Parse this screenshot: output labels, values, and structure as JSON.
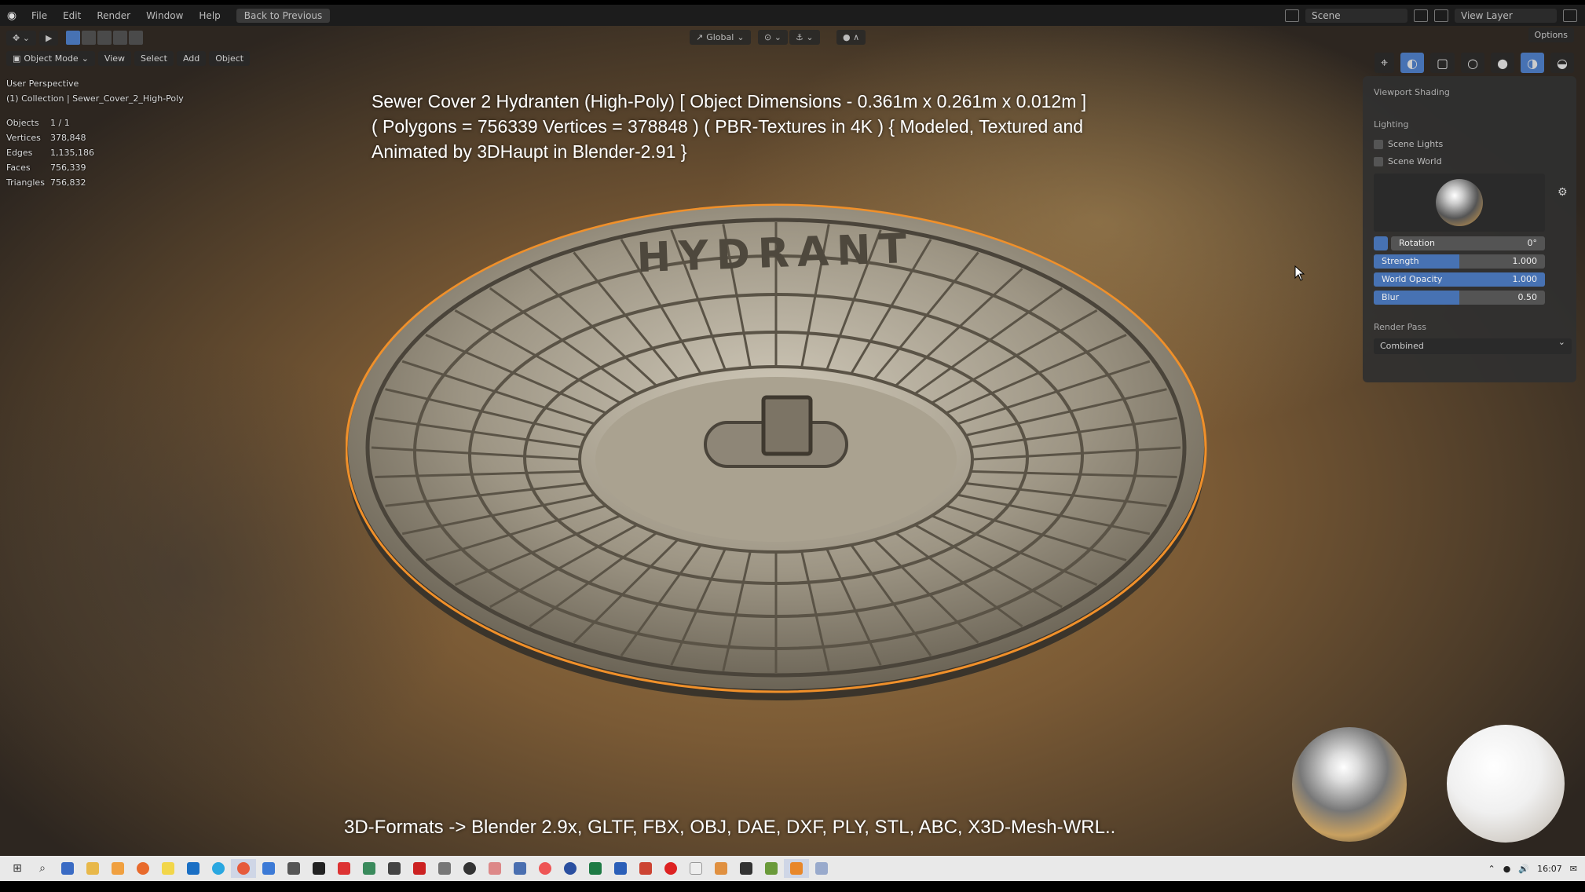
{
  "topbar": {
    "menus": [
      "File",
      "Edit",
      "Render",
      "Window",
      "Help"
    ],
    "back_button": "Back to Previous",
    "scene_field": "Scene",
    "view_layer": "View Layer"
  },
  "viewport": {
    "transform_orientation": "Global",
    "mode": "Object Mode",
    "menus": [
      "View",
      "Select",
      "Add",
      "Object"
    ],
    "options": "Options",
    "perspective": "User Perspective",
    "collection": "(1) Collection | Sewer_Cover_2_High-Poly",
    "stats": [
      {
        "k": "Objects",
        "v": "1 / 1"
      },
      {
        "k": "Vertices",
        "v": "378,848"
      },
      {
        "k": "Edges",
        "v": "1,135,186"
      },
      {
        "k": "Faces",
        "v": "756,339"
      },
      {
        "k": "Triangles",
        "v": "756,832"
      }
    ],
    "title_lines": [
      "Sewer Cover 2 Hydranten (High-Poly) [ Object Dimensions -  0.361m x 0.261m x 0.012m ]",
      "( Polygons = 756339 Vertices = 378848 ) ( PBR-Textures in 4K ) { Modeled, Textured and",
      "Animated by 3DHaupt in Blender-2.91 }"
    ],
    "formats": "3D-Formats -> Blender 2.9x, GLTF, FBX, OBJ, DAE, DXF, PLY, STL, ABC, X3D-Mesh-WRL..",
    "cover_text": "HYDRANT"
  },
  "shading_panel": {
    "title": "Viewport Shading",
    "lighting": "Lighting",
    "scene_lights": "Scene Lights",
    "scene_world": "Scene World",
    "rotation": {
      "label": "Rotation",
      "value": "0°",
      "fill": 0
    },
    "strength": {
      "label": "Strength",
      "value": "1.000",
      "fill": 0.5
    },
    "world_opacity": {
      "label": "World Opacity",
      "value": "1.000",
      "fill": 1.0
    },
    "blur": {
      "label": "Blur",
      "value": "0.50",
      "fill": 0.5
    },
    "render_pass_label": "Render Pass",
    "render_pass_value": "Combined"
  },
  "taskbar": {
    "clock": "16:07"
  }
}
